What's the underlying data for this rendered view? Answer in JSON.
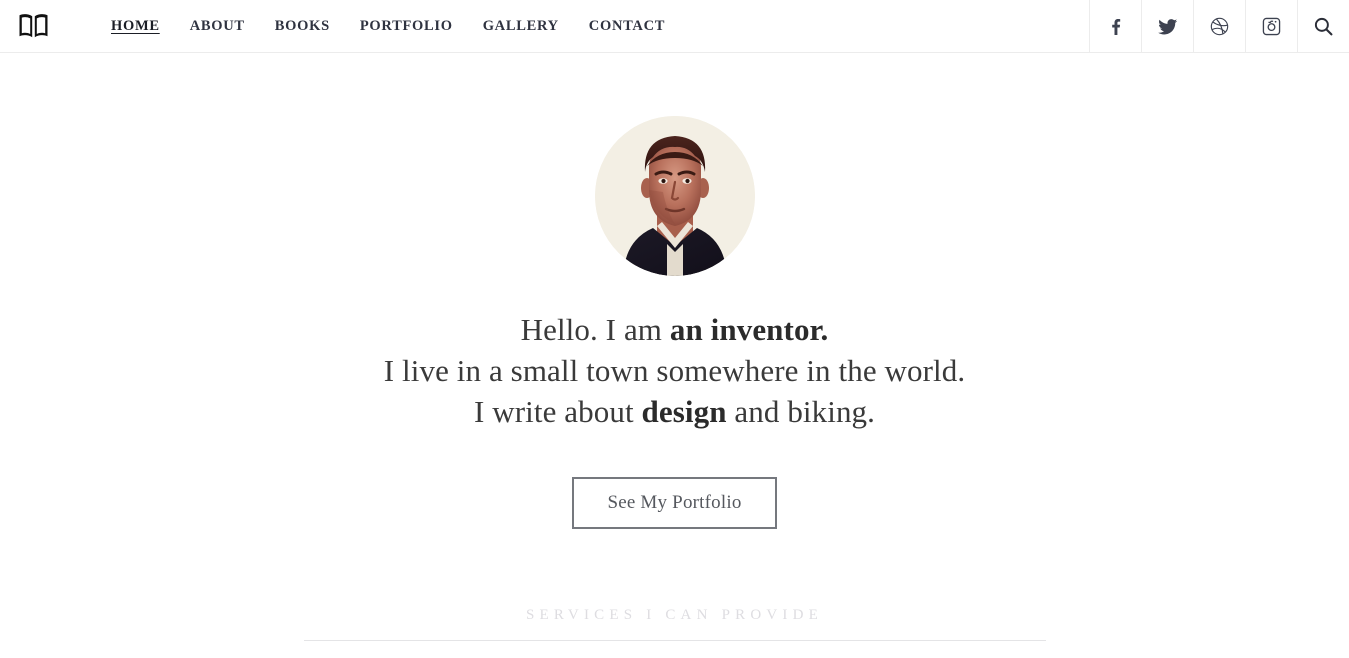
{
  "header": {
    "logo": {
      "icon": "open-book-icon",
      "label": "Open book logo"
    },
    "nav": [
      {
        "label": "HOME",
        "active": true
      },
      {
        "label": "ABOUT",
        "active": false
      },
      {
        "label": "BOOKS",
        "active": false
      },
      {
        "label": "PORTFOLIO",
        "active": false
      },
      {
        "label": "GALLERY",
        "active": false
      },
      {
        "label": "CONTACT",
        "active": false
      }
    ],
    "social": [
      {
        "icon": "facebook-icon",
        "label": "Facebook"
      },
      {
        "icon": "twitter-icon",
        "label": "Twitter"
      },
      {
        "icon": "dribbble-icon",
        "label": "Dribbble"
      },
      {
        "icon": "instagram-icon",
        "label": "Instagram"
      },
      {
        "icon": "search-icon",
        "label": "Search"
      }
    ]
  },
  "hero": {
    "avatar_alt": "Portrait photograph of a man in a dark jacket",
    "line1_prefix": "Hello. I am ",
    "line1_emphasis": "an inventor.",
    "line2": "I live in a small town somewhere in the world.",
    "line3_prefix": "I write about ",
    "line3_emphasis": "design",
    "line3_suffix": " and biking.",
    "cta_label": "See My Portfolio"
  },
  "services": {
    "heading": "SERVICES I CAN PROVIDE"
  },
  "colors": {
    "page_background": "#ffffff",
    "nav_text": "#2f3340",
    "hero_text": "#3a3a3a",
    "button_border": "#75787e",
    "header_border": "#ececec",
    "services_heading": "#dedde1",
    "avatar_background": "#f3efe4"
  }
}
